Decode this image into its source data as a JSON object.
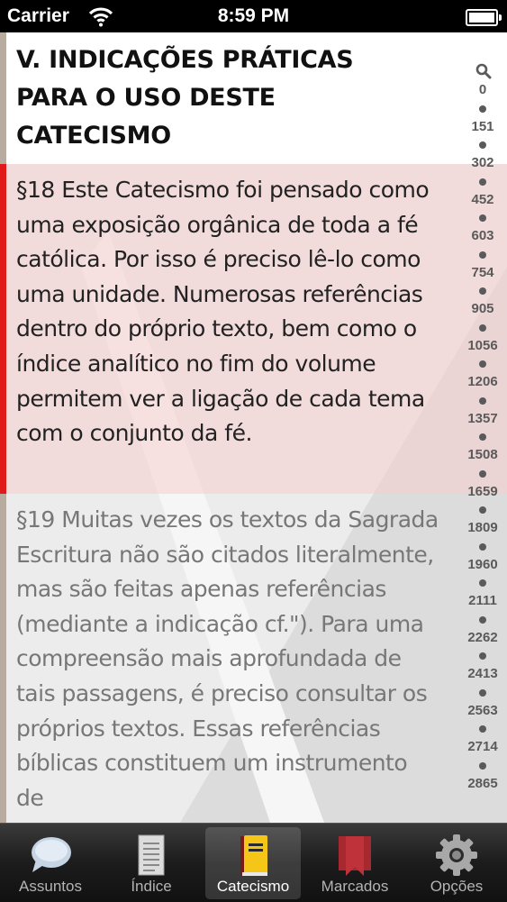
{
  "status_bar": {
    "carrier": "Carrier",
    "time": "8:59 PM"
  },
  "heading": "V. INDICAÇÕES PRÁTICAS PARA O USO DESTE CATECISMO",
  "paragraphs": [
    {
      "text": "§18 Este Catecismo foi pensado como uma exposição orgânica de toda a fé católica. Por isso é preciso lê-lo como uma unidade. Numerosas referências dentro do próprio texto, bem como o índice analítico no fim do volume permitem ver a ligação de cada tema com o conjunto da fé.",
      "highlighted": true
    },
    {
      "text": "§19 Muitas vezes os textos da Sagrada Escritura não são citados literalmente, mas são feitas apenas referências (mediante a indicação cf.\"). Para uma compreensão mais aprofundada de tais passagens, é preciso consultar os próprios textos. Essas referências bíblicas constituem um instrumento de",
      "highlighted": false
    }
  ],
  "scroll_index": {
    "search_icon": "magnifier-icon",
    "marks": [
      "0",
      "151",
      "302",
      "452",
      "603",
      "754",
      "905",
      "1056",
      "1206",
      "1357",
      "1508",
      "1659",
      "1809",
      "1960",
      "2111",
      "2262",
      "2413",
      "2563",
      "2714",
      "2865"
    ]
  },
  "tabs": [
    {
      "label": "Assuntos",
      "icon": "speech-bubble-icon",
      "selected": false
    },
    {
      "label": "Índice",
      "icon": "document-list-icon",
      "selected": false
    },
    {
      "label": "Catecismo",
      "icon": "book-icon",
      "selected": true
    },
    {
      "label": "Marcados",
      "icon": "bookmark-icon",
      "selected": false
    },
    {
      "label": "Opções",
      "icon": "gear-icon",
      "selected": false
    }
  ],
  "colors": {
    "highlight_bar": "#e01a1a",
    "highlight_bg": "#f8cdcd",
    "book_cover": "#f5c518",
    "bookmark": "#c0323a"
  }
}
